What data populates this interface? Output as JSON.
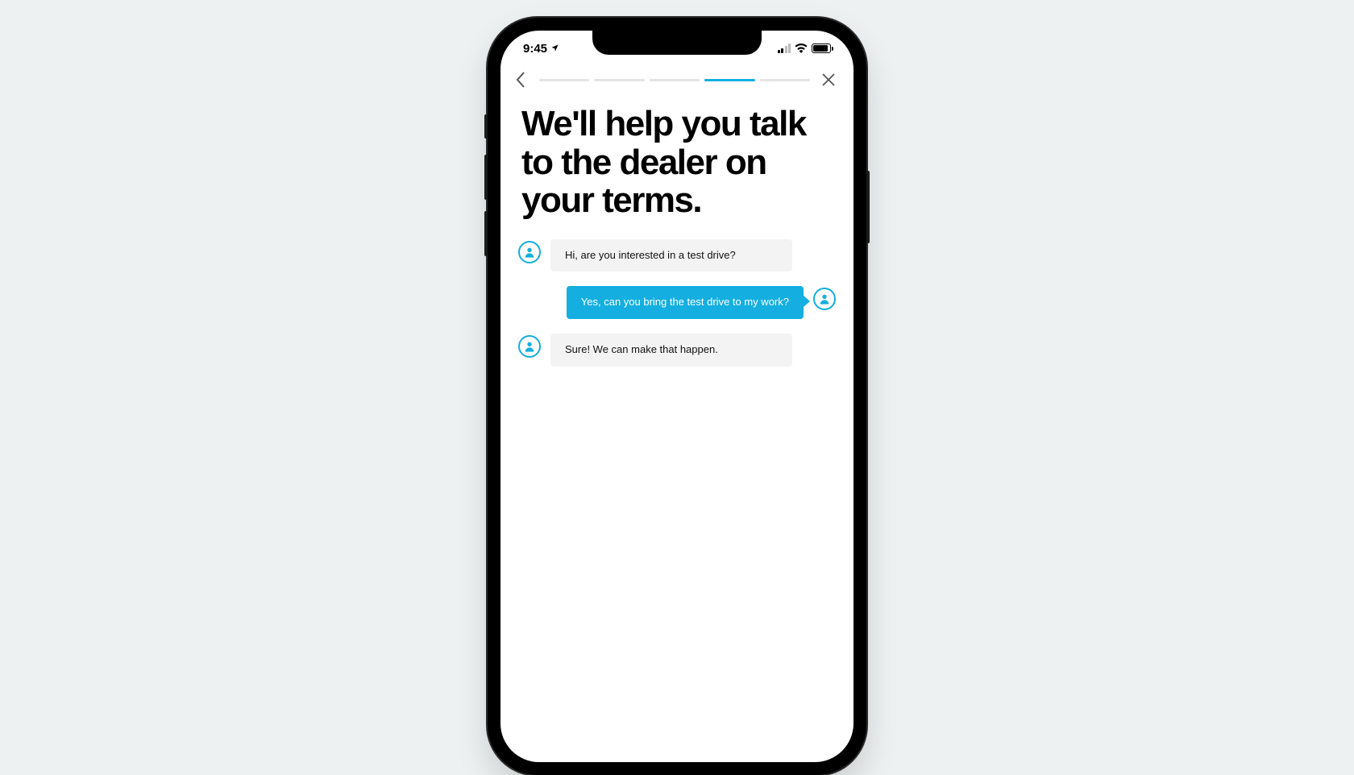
{
  "statusbar": {
    "time": "9:45"
  },
  "nav": {
    "progress_segments": 5,
    "active_segment_index": 3
  },
  "heading": "We'll help you talk to the dealer on your terms.",
  "chat": [
    {
      "side": "left",
      "text": "Hi, are you interested in a test drive?"
    },
    {
      "side": "right",
      "text": "Yes, can you bring the test drive to my work?"
    },
    {
      "side": "left",
      "text": "Sure! We can make that happen."
    }
  ],
  "colors": {
    "accent": "#14aee0"
  }
}
